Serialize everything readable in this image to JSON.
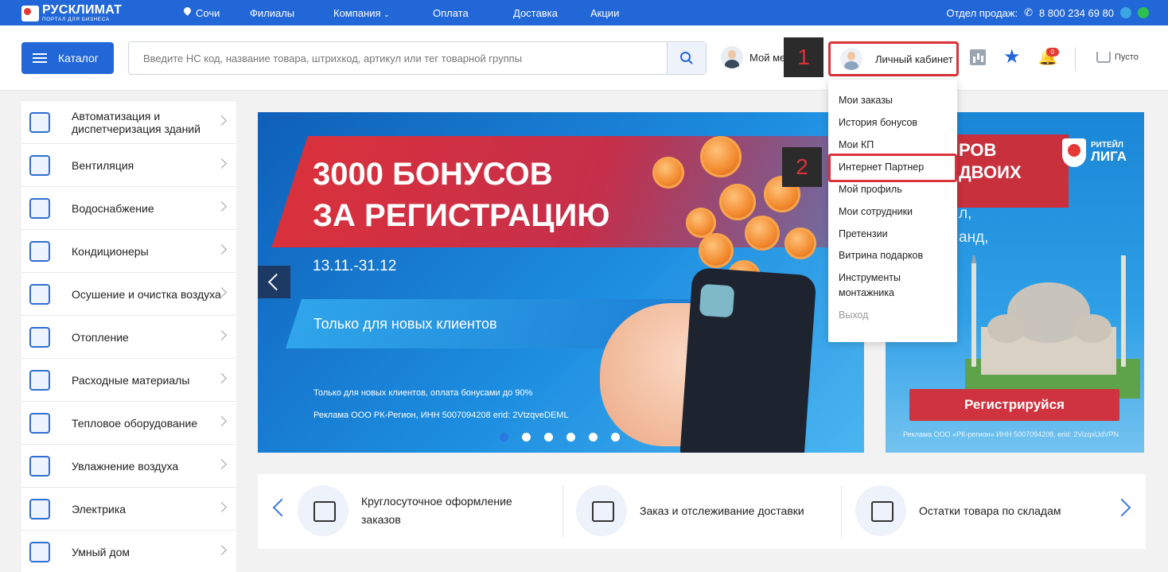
{
  "topbar": {
    "logo_title": "РУСКЛИМАТ",
    "logo_subtitle": "ПОРТАЛ ДЛЯ БИЗНЕСА",
    "city": "Сочи",
    "nav": [
      "Филиалы",
      "Компания",
      "Оплата",
      "Доставка",
      "Акции"
    ],
    "sales_label": "Отдел продаж:",
    "phone": "8 800 234 69 80"
  },
  "header": {
    "catalog_label": "Каталог",
    "search_placeholder": "Введите НС код, название товара, штрихкод, артикул или тег товарной группы",
    "manager_label": "Мой менеджер",
    "account_label": "Личный кабинет",
    "notifications_count": "0",
    "cart_label": "Пусто"
  },
  "steps": {
    "first": "1",
    "second": "2"
  },
  "account_menu": {
    "items": [
      "Мои заказы",
      "История бонусов",
      "Мои КП",
      "Интернет Партнер",
      "Мой профиль",
      "Мои сотрудники",
      "Претензии",
      "Витрина подарков",
      "Инструменты монтажника",
      "Выход"
    ]
  },
  "sidebar": {
    "items": [
      {
        "label": "Автоматизация и диспетчеризация зданий"
      },
      {
        "label": "Вентиляция"
      },
      {
        "label": "Водоснабжение"
      },
      {
        "label": "Кондиционеры"
      },
      {
        "label": "Осушение и очистка воздуха"
      },
      {
        "label": "Отопление"
      },
      {
        "label": "Расходные материалы"
      },
      {
        "label": "Тепловое оборудование"
      },
      {
        "label": "Увлажнение воздуха"
      },
      {
        "label": "Электрика"
      },
      {
        "label": "Умный дом"
      }
    ]
  },
  "banner": {
    "headline_1": "3000 БОНУСОВ",
    "headline_2": "ЗА РЕГИСТРАЦИЮ",
    "dates": "13.11.-31.12",
    "subtitle": "Только для новых клиентов",
    "fine_1": "Только для новых клиентов, оплата бонусами до 90%",
    "fine_2": "Реклама ООО РК-Регион, ИНН 5007094208 erid: 2VtzqveDEML"
  },
  "side_banner": {
    "title_1": "РОВ",
    "title_2": "ДВОИХ",
    "text_1": "л,",
    "text_2": "анд,",
    "brand_small": "РИТЕЙЛ",
    "brand_big": "ЛИГА",
    "button": "Регистрируйся",
    "fine": "Реклама ООО «РК-регион» ИНН 5007094208, erid: 2VizqxUdVPN"
  },
  "features": [
    {
      "label_1": "Круглосуточное оформление",
      "label_2": "заказов"
    },
    {
      "label_1": "Заказ и отслеживание доставки",
      "label_2": ""
    },
    {
      "label_1": "Остатки товара по складам",
      "label_2": ""
    }
  ]
}
